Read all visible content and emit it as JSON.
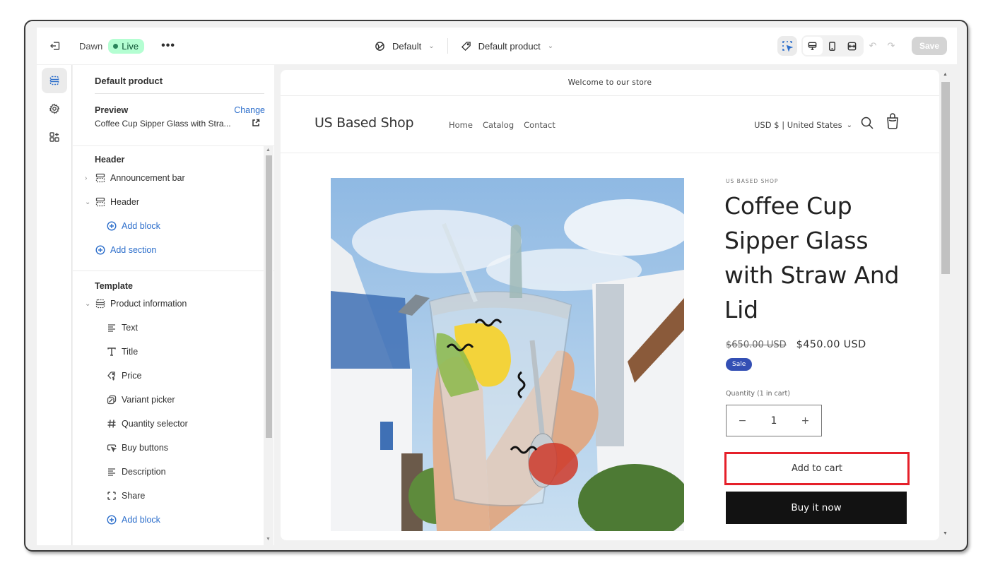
{
  "topbar": {
    "theme_name": "Dawn",
    "live_label": "Live",
    "more_label": "•••",
    "theme_dropdown": "Default",
    "template_dropdown": "Default product",
    "save_label": "Save",
    "icons": {
      "exit": "exit-icon",
      "globe": "globe-icon",
      "tag": "tag-icon",
      "inspect": "inspector-icon",
      "desktop": "desktop-icon",
      "mobile": "mobile-icon",
      "fullwidth": "fullwidth-icon",
      "undo": "undo-icon",
      "redo": "redo-icon"
    }
  },
  "rail": {
    "items": [
      {
        "name": "sections",
        "icon": "sections-icon",
        "active": true
      },
      {
        "name": "theme-settings",
        "icon": "gear-icon",
        "active": false
      },
      {
        "name": "app-embeds",
        "icon": "apps-add-icon",
        "active": false
      }
    ]
  },
  "panel": {
    "title": "Default product",
    "preview_label": "Preview",
    "change_label": "Change",
    "preview_value": "Coffee Cup Sipper Glass with Stra...",
    "header_group": {
      "title": "Header",
      "items": [
        {
          "label": "Announcement bar",
          "expanded": false
        },
        {
          "label": "Header",
          "expanded": true
        }
      ],
      "add_block": "Add block",
      "add_section": "Add section"
    },
    "template_group": {
      "title": "Template",
      "section": "Product information",
      "blocks": [
        {
          "label": "Text",
          "icon": "text-icon"
        },
        {
          "label": "Title",
          "icon": "title-icon"
        },
        {
          "label": "Price",
          "icon": "price-tag-icon"
        },
        {
          "label": "Variant picker",
          "icon": "variant-icon"
        },
        {
          "label": "Quantity selector",
          "icon": "hash-icon"
        },
        {
          "label": "Buy buttons",
          "icon": "buy-button-icon"
        },
        {
          "label": "Description",
          "icon": "description-icon"
        },
        {
          "label": "Share",
          "icon": "share-icon"
        }
      ],
      "add_block": "Add block"
    }
  },
  "storefront": {
    "announcement": "Welcome to our store",
    "shop_name": "US Based Shop",
    "nav": [
      "Home",
      "Catalog",
      "Contact"
    ],
    "currency": "USD $ | United States",
    "product": {
      "vendor": "US BASED SHOP",
      "title": "Coffee Cup Sipper Glass with Straw And Lid",
      "compare_price": "$650.00 USD",
      "price": "$450.00 USD",
      "badge": "Sale",
      "quantity_label": "Quantity (1 in cart)",
      "quantity": "1",
      "add_to_cart": "Add to cart",
      "buy_now": "Buy it now"
    },
    "highlight_color": "#e5202a"
  }
}
